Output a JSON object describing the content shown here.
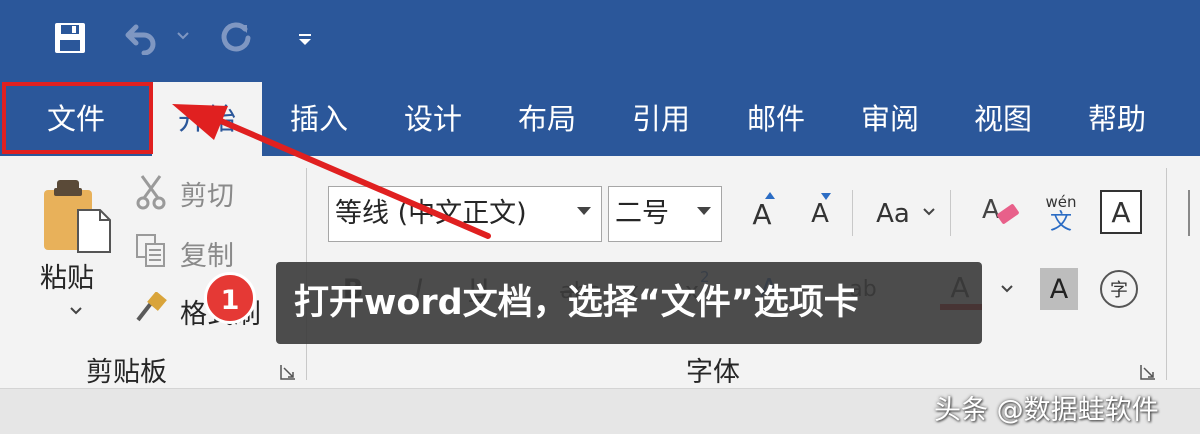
{
  "quick_access": {
    "save_icon": "save-icon",
    "undo_icon": "undo-icon",
    "redo_icon": "redo-icon",
    "customize_icon": "customize-qat-icon"
  },
  "tabs": [
    {
      "label": "文件",
      "active": false
    },
    {
      "label": "开始",
      "active": true
    },
    {
      "label": "插入",
      "active": false
    },
    {
      "label": "设计",
      "active": false
    },
    {
      "label": "布局",
      "active": false
    },
    {
      "label": "引用",
      "active": false
    },
    {
      "label": "邮件",
      "active": false
    },
    {
      "label": "审阅",
      "active": false
    },
    {
      "label": "视图",
      "active": false
    },
    {
      "label": "帮助",
      "active": false
    }
  ],
  "clipboard": {
    "paste_label": "粘贴",
    "cut_label": "剪切",
    "copy_label": "复制",
    "format_painter_label": "格式刷",
    "group_label": "剪贴板"
  },
  "font": {
    "font_name": "等线 (中文正文)",
    "font_size": "二号",
    "grow_label": "A",
    "shrink_label": "A",
    "change_case_label": "Aa",
    "phonetic_top": "wén",
    "phonetic_bottom": "文",
    "border_char_label": "A",
    "bold_label": "B",
    "italic_label": "I",
    "underline_label": "U",
    "strike_label": "abc",
    "subscript_label": "x",
    "superscript_label": "x",
    "superscript_mark": "2",
    "text_effect_label": "A",
    "highlight_label": "ab",
    "font_color_label": "A",
    "shading_label": "A",
    "enclose_label": "字",
    "group_label": "字体"
  },
  "overlay": {
    "step_number": "1",
    "instruction": "打开word文档，选择“文件”选项卡"
  },
  "watermark": "头条 @数据蛙软件",
  "colors": {
    "ribbon_blue": "#2b579a",
    "highlight_red": "#e02020",
    "font_color_bar": "#c00000",
    "badge_red": "#e53935"
  }
}
